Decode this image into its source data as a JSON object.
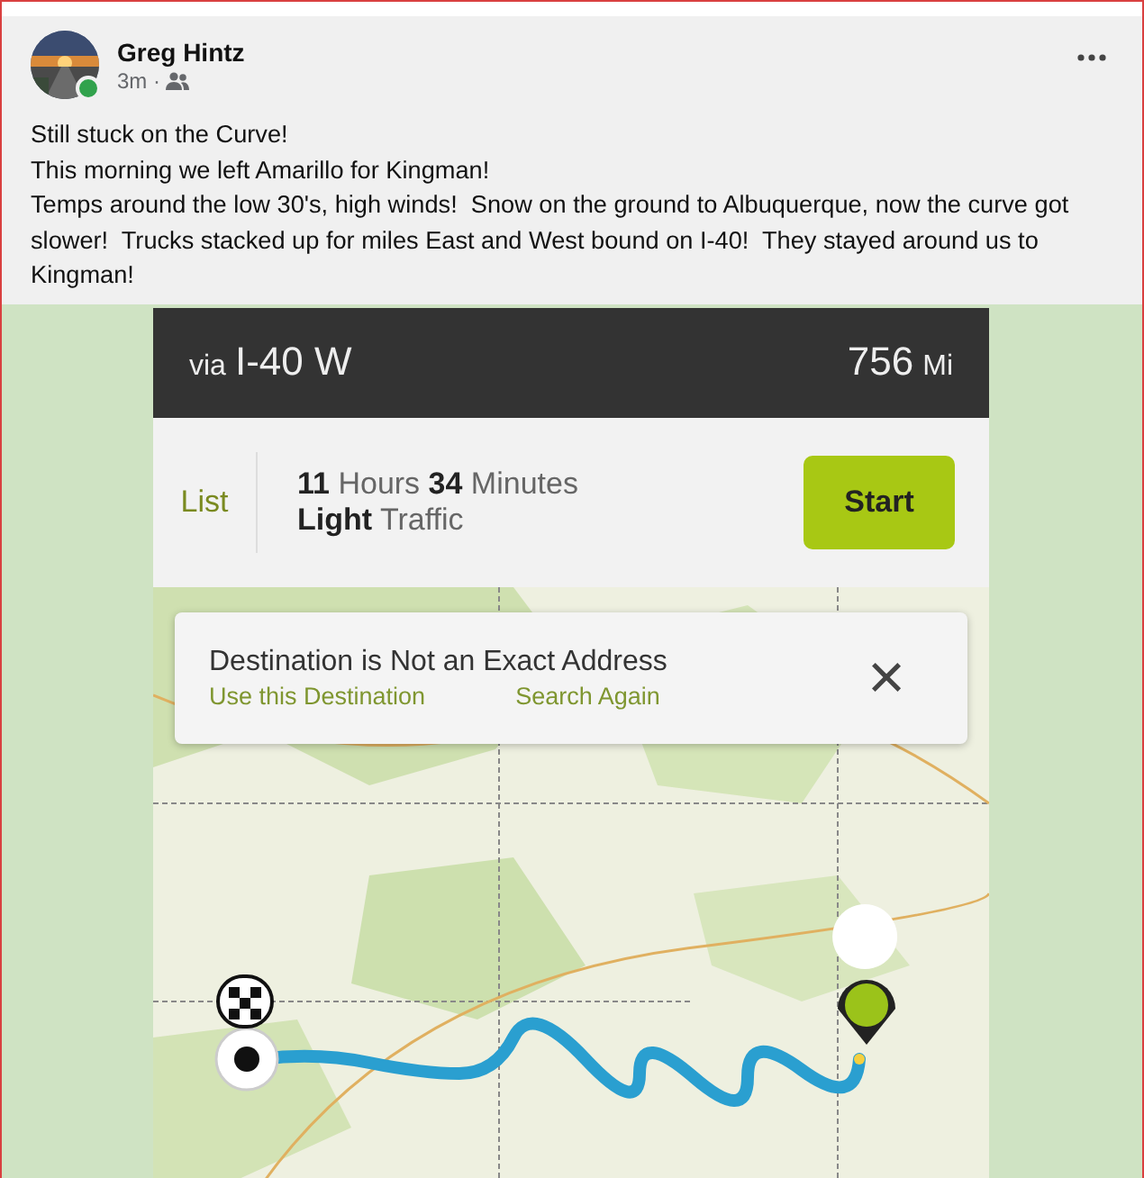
{
  "post": {
    "author": "Greg Hintz",
    "online": true,
    "time": "3m ·",
    "body_lines": [
      "Still stuck on the Curve!",
      "This morning we left Amarillo for Kingman!",
      "Temps around the low 30's, high winds!  Snow on the ground to Albuquerque, now the curve got slower!  Trucks stacked up for miles East and West bound on I-40!  They stayed around us to Kingman!"
    ]
  },
  "navigation": {
    "route_prefix": "via",
    "route": "I-40 W",
    "distance": "756",
    "distance_unit": "Mi",
    "list_button": "List",
    "duration": "**11** Hours **34** Minutes",
    "traffic": "**Light** Traffic",
    "start_button": "Start",
    "alert": {
      "title": "Destination is Not an Exact Address",
      "actions": [
        "Use this Destination",
        "Search Again"
      ],
      "close": "×"
    }
  }
}
